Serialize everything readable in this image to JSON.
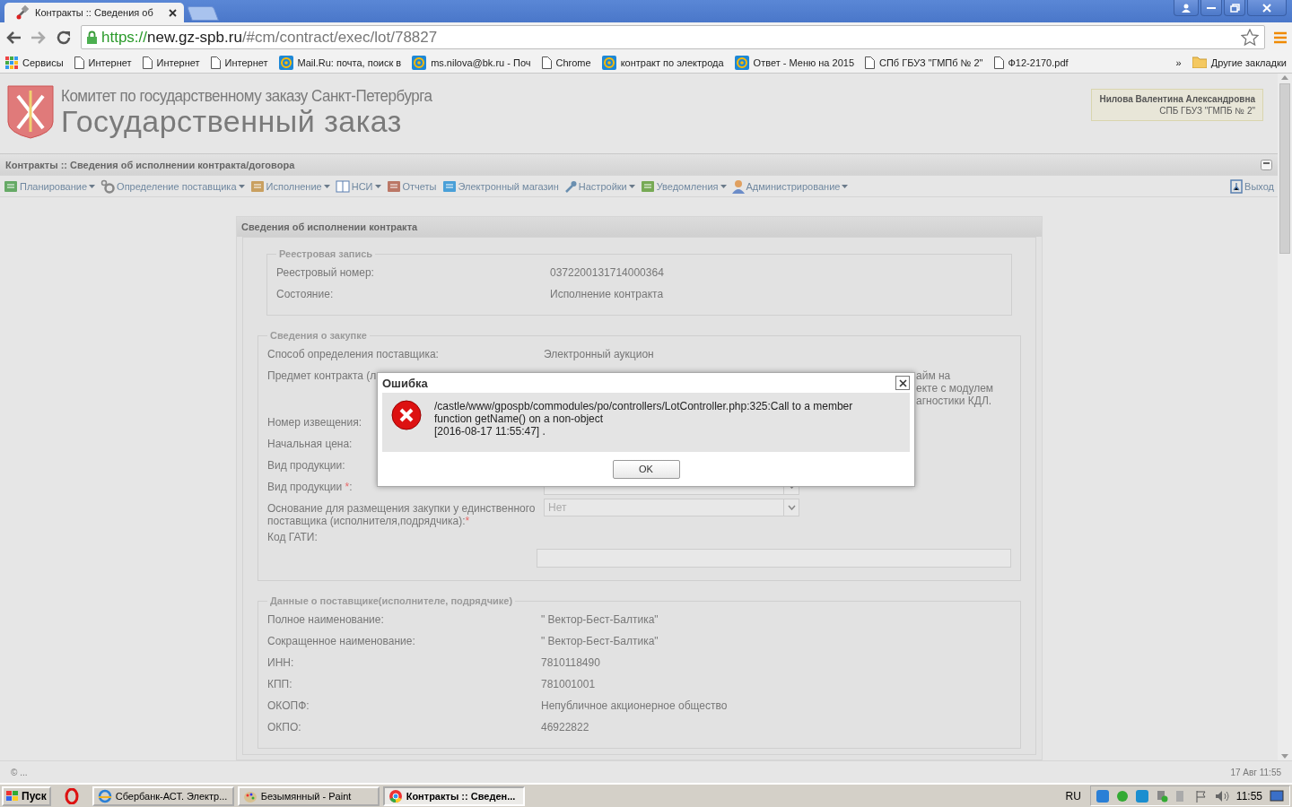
{
  "browser": {
    "tab_title": "Контракты :: Сведения об ",
    "url_scheme": "https://",
    "url_host": "new.gz-spb.ru",
    "url_path": "/#cm/contract/exec/lot/78827",
    "bookmarks": [
      {
        "kind": "apps",
        "label": "Сервисы"
      },
      {
        "kind": "page",
        "label": "Интернет"
      },
      {
        "kind": "page",
        "label": "Интернет"
      },
      {
        "kind": "page",
        "label": "Интернет"
      },
      {
        "kind": "mail",
        "label": "Mail.Ru: почта, поиск в"
      },
      {
        "kind": "mail",
        "label": "ms.nilova@bk.ru - Поч"
      },
      {
        "kind": "page",
        "label": "Chrome"
      },
      {
        "kind": "mail",
        "label": "контракт по электрода"
      },
      {
        "kind": "mail",
        "label": "Ответ - Меню на 2015"
      },
      {
        "kind": "page",
        "label": "СПб ГБУЗ \"ГМПб № 2\""
      },
      {
        "kind": "page",
        "label": "Ф12-2170.pdf"
      }
    ],
    "overflow": "»",
    "other_bookmarks": "Другие закладки"
  },
  "header": {
    "subtitle": "Комитет по государственному заказу Санкт-Петербурга",
    "title": "Государственный заказ",
    "user_name": "Нилова Валентина Александровна",
    "user_org": "СПБ ГБУЗ \"ГМПБ № 2\""
  },
  "breadcrumb": "Контракты :: Сведения об исполнении контракта/договора",
  "menu": [
    {
      "label": "Планирование",
      "dropdown": true
    },
    {
      "label": "Определение поставщика",
      "dropdown": true
    },
    {
      "label": "Исполнение",
      "dropdown": true
    },
    {
      "label": "НСИ",
      "dropdown": true
    },
    {
      "label": "Отчеты",
      "dropdown": false
    },
    {
      "label": "Электронный магазин",
      "dropdown": false
    },
    {
      "label": "Настройки",
      "dropdown": true
    },
    {
      "label": "Уведомления",
      "dropdown": true
    },
    {
      "label": "Администрирование",
      "dropdown": true
    }
  ],
  "exit": "Выход",
  "panel": {
    "title": "Сведения об исполнении контракта",
    "sections": [
      {
        "legend": "Реестровая запись",
        "rows": [
          {
            "kind": "text",
            "label": "Реестровый номер:",
            "value": "0372200131714000364"
          },
          {
            "kind": "text",
            "label": "Состояние:",
            "value": "Исполнение контракта"
          }
        ]
      },
      {
        "legend": "Сведения о закупке",
        "rows": [
          {
            "kind": "text",
            "label": "Способ определения поставщика:",
            "value": "Электронный аукцион"
          },
          {
            "kind": "cut",
            "label": "Предмет контракта (л",
            "lines": [
              "айм на",
              "екте с модулем",
              "агностики КДЛ."
            ]
          },
          {
            "kind": "text",
            "label": "Номер извещения:"
          },
          {
            "kind": "text",
            "label": "Начальная цена:"
          },
          {
            "kind": "text",
            "label": "Вид продукции:"
          },
          {
            "kind": "select",
            "label": "Вид продукции ",
            "required_mark": "*",
            "label_end": ":"
          },
          {
            "kind": "select",
            "label": "Основание для размещения закупки у единственного поставщика (исполнителя,подрядчика):",
            "required_mark": "*",
            "value": "Нет"
          },
          {
            "kind": "input",
            "label": "Код ГАТИ:"
          }
        ]
      },
      {
        "legend": "Данные о поставщике(исполнителе, подрядчике)",
        "rows": [
          {
            "kind": "text",
            "label": "Полное наименование:",
            "value": "\" Вектор-Бест-Балтика\""
          },
          {
            "kind": "text",
            "label": "Сокращенное наименование:",
            "value": "\" Вектор-Бест-Балтика\""
          },
          {
            "kind": "text",
            "label": "ИНН:",
            "value": "7810118490"
          },
          {
            "kind": "text",
            "label": "КПП:",
            "value": "781001001"
          },
          {
            "kind": "text",
            "label": "ОКОПФ:",
            "value": "Непубличное акционерное общество"
          },
          {
            "kind": "text",
            "label": "ОКПО:",
            "value": "46922822"
          }
        ]
      }
    ]
  },
  "dialog": {
    "title": "Ошибка",
    "message": [
      "/castle/www/gpospb/commodules/po/controllers/LotController.php:325:Call to a member",
      "function getName() on a non-object",
      "[2016-08-17 11:55:47] ."
    ],
    "button": "OK"
  },
  "status_bar": {
    "left": "© ...",
    "right": "17 Авг 11:55"
  },
  "taskbar": {
    "start": "Пуск",
    "items": [
      {
        "label": "Сбербанк-АСТ. Электр...",
        "selected": false
      },
      {
        "label": "Безымянный - Paint",
        "selected": false
      },
      {
        "label": "Контракты :: Сведен...",
        "selected": true
      }
    ],
    "language": "RU",
    "clock": "11:55"
  }
}
